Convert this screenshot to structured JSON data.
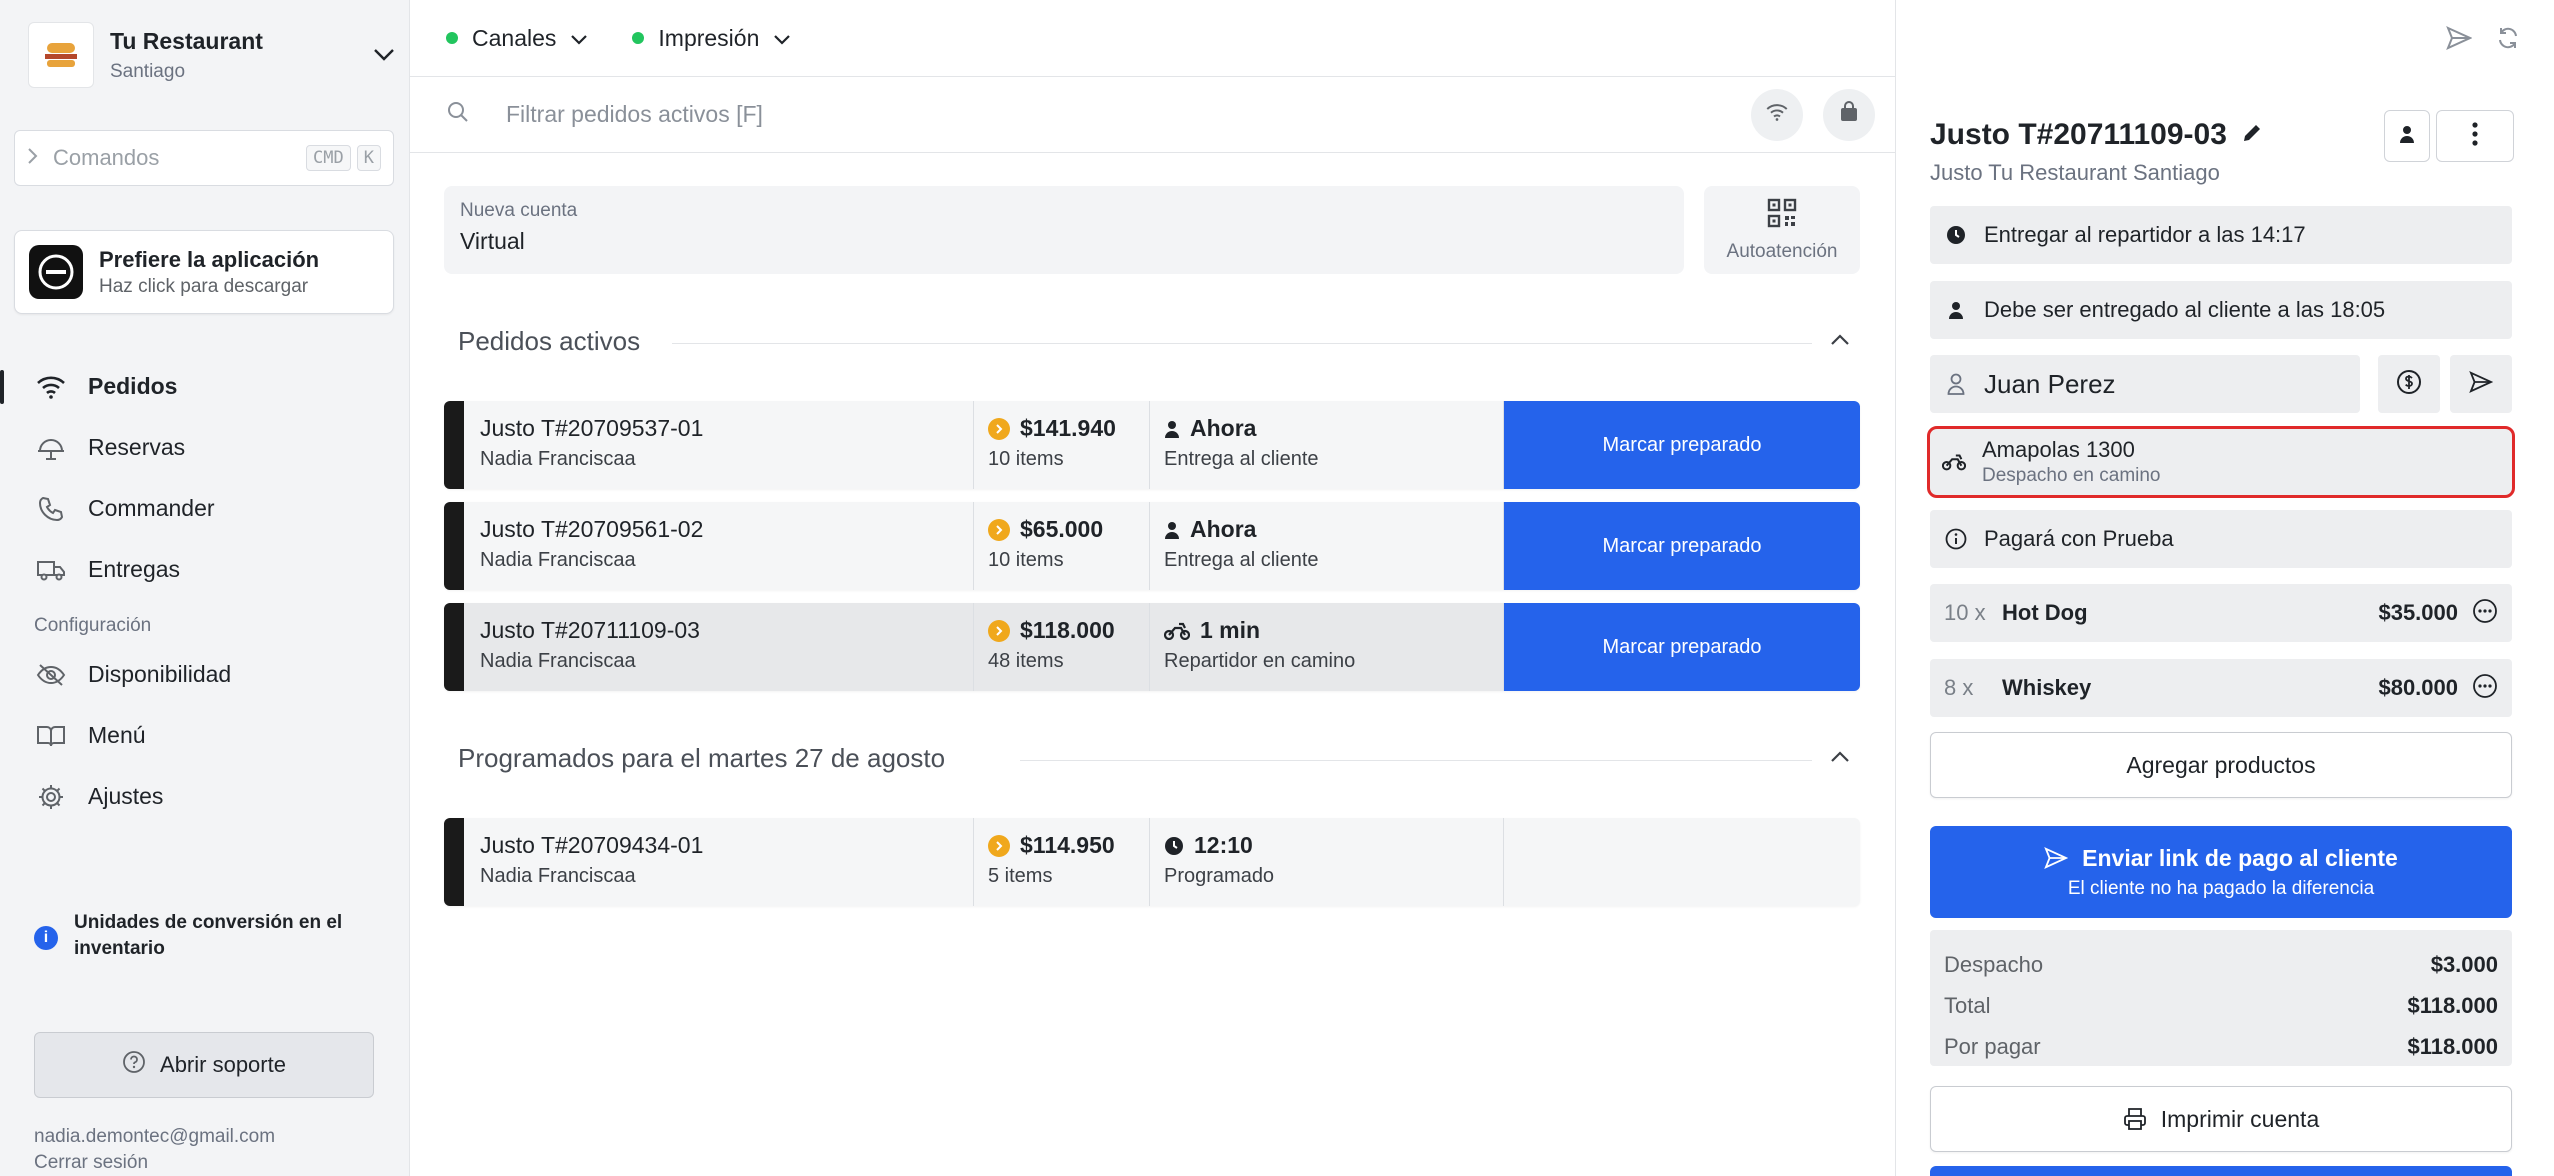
{
  "sidebar": {
    "brand": {
      "name": "Tu Restaurant",
      "city": "Santiago"
    },
    "commands": {
      "placeholder": "Comandos",
      "kbd1": "CMD",
      "kbd2": "K"
    },
    "app_promo": {
      "title": "Prefiere la aplicación",
      "subtitle": "Haz click para descargar"
    },
    "nav": [
      {
        "label": "Pedidos",
        "icon": "wifi-icon",
        "active": true
      },
      {
        "label": "Reservas",
        "icon": "cloche-icon"
      },
      {
        "label": "Commander",
        "icon": "phone-icon"
      },
      {
        "label": "Entregas",
        "icon": "truck-icon"
      }
    ],
    "config_label": "Configuración",
    "config_nav": [
      {
        "label": "Disponibilidad",
        "icon": "eye-off-icon"
      },
      {
        "label": "Menú",
        "icon": "book-icon"
      },
      {
        "label": "Ajustes",
        "icon": "gear-icon"
      }
    ],
    "info_note": "Unidades de conversión en el inventario",
    "support_button": "Abrir soporte",
    "email": "nadia.demontec@gmail.com",
    "logout": "Cerrar sesión"
  },
  "topbar": {
    "channels": "Canales",
    "printing": "Impresión",
    "status_color": "#22c55e"
  },
  "search": {
    "placeholder": "Filtrar pedidos activos [F]"
  },
  "new_account": {
    "label": "Nueva cuenta",
    "value": "Virtual",
    "self_service": "Autoatención"
  },
  "active_section": "Pedidos activos",
  "active_orders": [
    {
      "id": "Justo T#20709537-01",
      "customer": "Nadia Franciscaa",
      "amount": "$141.940",
      "items": "10 items",
      "time": "Ahora",
      "status": "Entrega al cliente",
      "action": "Marcar preparado"
    },
    {
      "id": "Justo T#20709561-02",
      "customer": "Nadia Franciscaa",
      "amount": "$65.000",
      "items": "10 items",
      "time": "Ahora",
      "status": "Entrega al cliente",
      "action": "Marcar preparado"
    },
    {
      "id": "Justo T#20711109-03",
      "customer": "Nadia Franciscaa",
      "amount": "$118.000",
      "items": "48 items",
      "time": "1 min",
      "status": "Repartidor en camino",
      "action": "Marcar preparado"
    }
  ],
  "scheduled_section": "Programados para el martes 27 de agosto",
  "scheduled_orders": [
    {
      "id": "Justo T#20709434-01",
      "customer": "Nadia Franciscaa",
      "amount": "$114.950",
      "items": "5 items",
      "time": "12:10",
      "status": "Programado"
    }
  ],
  "detail": {
    "title": "Justo T#20711109-03",
    "subtitle": "Justo Tu Restaurant Santiago",
    "handoff": "Entregar al repartidor a las 14:17",
    "deliver_by": "Debe ser entregado al cliente a las 18:05",
    "customer_name": "Juan Perez",
    "address": "Amapolas 1300",
    "address_status": "Despacho en camino",
    "payment": "Pagará con Prueba",
    "items": [
      {
        "qty": "10 x",
        "name": "Hot Dog",
        "price": "$35.000"
      },
      {
        "qty": "8 x",
        "name": "Whiskey",
        "price": "$80.000"
      }
    ],
    "add_products": "Agregar productos",
    "send_link": "Enviar link de pago al cliente",
    "send_link_sub": "El cliente no ha pagado la diferencia",
    "totals": [
      {
        "label": "Despacho",
        "value": "$3.000"
      },
      {
        "label": "Total",
        "value": "$118.000"
      },
      {
        "label": "Por pagar",
        "value": "$118.000"
      }
    ],
    "print": "Imprimir cuenta",
    "accent": "#2563eb",
    "highlight_color": "#e02a2a"
  }
}
